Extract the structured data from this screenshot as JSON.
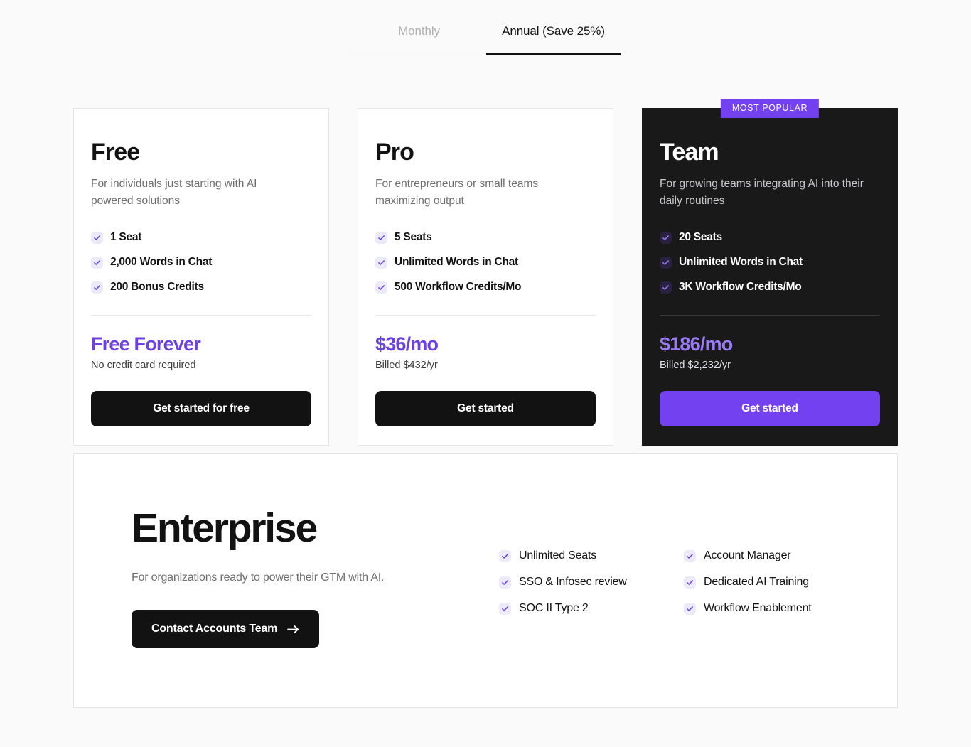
{
  "billing_tabs": [
    {
      "label": "Monthly",
      "active": false
    },
    {
      "label": "Annual (Save 25%)",
      "active": true
    }
  ],
  "plans": [
    {
      "name": "Free",
      "description": "For individuals just starting with AI powered solutions",
      "features": [
        "1 Seat",
        "2,000 Words in Chat",
        "200 Bonus Credits"
      ],
      "price": "Free Forever",
      "price_note": "No credit card required",
      "cta_label": "Get started for free"
    },
    {
      "name": "Pro",
      "description": "For entrepreneurs or small teams maximizing output",
      "features": [
        "5 Seats",
        "Unlimited Words in Chat",
        "500 Workflow Credits/Mo"
      ],
      "price": "$36/mo",
      "price_note": "Billed $432/yr",
      "cta_label": "Get started"
    },
    {
      "name": "Team",
      "badge": "MOST POPULAR",
      "description": "For growing teams integrating AI into their daily routines",
      "features": [
        "20 Seats",
        "Unlimited Words in Chat",
        "3K Workflow Credits/Mo"
      ],
      "price": "$186/mo",
      "price_note": "Billed $2,232/yr",
      "cta_label": "Get started"
    }
  ],
  "enterprise": {
    "title": "Enterprise",
    "description": "For organizations ready to power their GTM with AI.",
    "cta_label": "Contact Accounts Team",
    "features": [
      "Unlimited Seats",
      "Account Manager",
      "SSO & Infosec review",
      "Dedicated AI Training",
      "SOC II Type 2",
      "Workflow Enablement"
    ]
  },
  "colors": {
    "accent_purple": "#7341f0",
    "price_purple": "#6c41e0",
    "price_purple_dark_card": "#9a7bf5",
    "dark_card": "#191919",
    "page_background": "#fafafa"
  }
}
